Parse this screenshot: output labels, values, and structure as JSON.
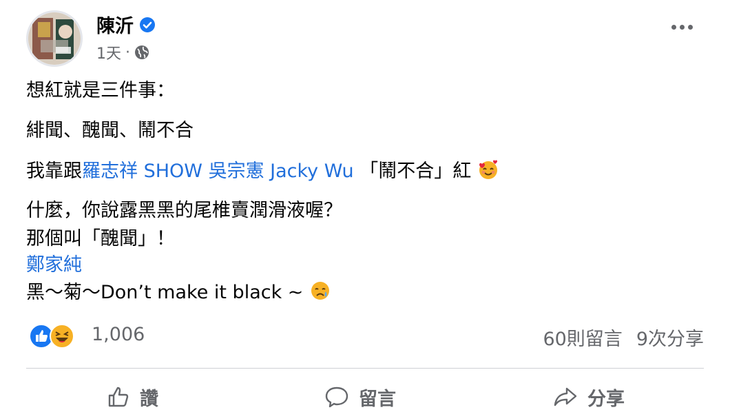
{
  "post": {
    "author": "陳沂",
    "timestamp": "1天",
    "separator": "·",
    "audience_icon": "globe-icon",
    "more_icon": "more-options-icon",
    "lines": {
      "l1": "想紅就是三件事：",
      "l2": "緋聞、醜聞、鬧不合",
      "l3_prefix": "我靠跟",
      "l3_link1": "羅志祥 SHOW",
      "l3_link2": "吳宗憲 Jacky Wu",
      "l3_suffix": " 「鬧不合」紅",
      "l4": "什麼，你說露黑黑的尾椎賣潤滑液喔？",
      "l5": "那個叫「醜聞」！",
      "l6_link": "鄭家純",
      "l7": "黑～菊～Don’t make it black ~"
    },
    "emoji": [
      "smiling-face-with-hearts-emoji",
      "tear-face-emoji"
    ]
  },
  "stats": {
    "reaction_icons": [
      "like-icon",
      "haha-icon"
    ],
    "reaction_count": "1,006",
    "comments": "60則留言",
    "shares": "9次分享"
  },
  "actions": {
    "like": "讚",
    "comment": "留言",
    "share": "分享"
  },
  "colors": {
    "link": "#216fdb",
    "verified": "#1877f2",
    "secondary_text": "#65676b",
    "like_blue": "#1877f2",
    "haha_yellow": "#f7b125"
  }
}
